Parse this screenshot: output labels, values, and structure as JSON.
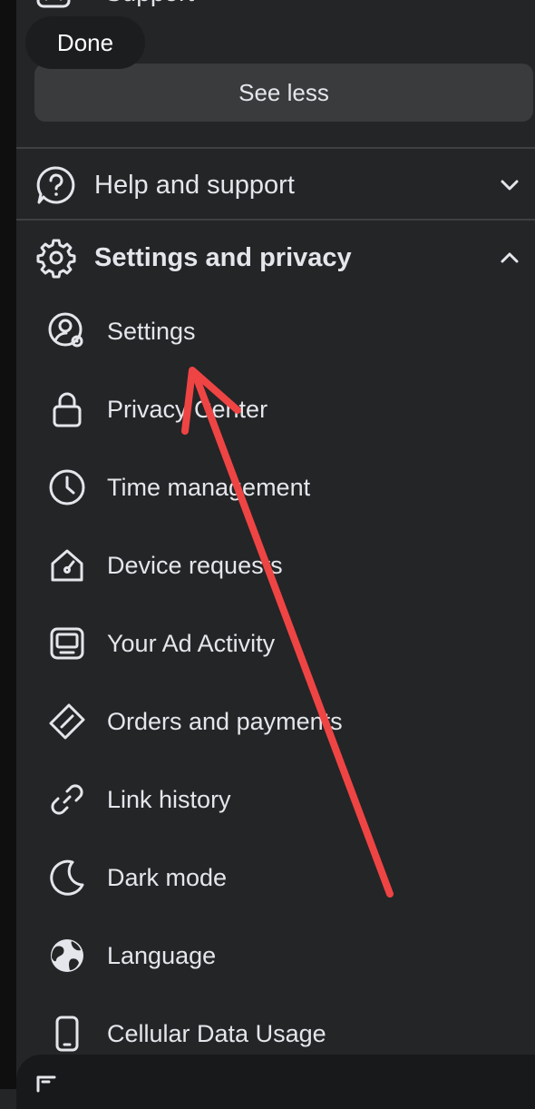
{
  "top": {
    "support_label": "Support",
    "done_label": "Done",
    "see_less_label": "See less"
  },
  "sections": {
    "help": {
      "label": "Help and support",
      "icon": "question-bubble-icon",
      "expanded": false
    },
    "settings": {
      "label": "Settings and privacy",
      "icon": "gear-icon",
      "expanded": true
    }
  },
  "menu": [
    {
      "label": "Settings",
      "icon": "user-gear-icon"
    },
    {
      "label": "Privacy Center",
      "icon": "lock-icon"
    },
    {
      "label": "Time management",
      "icon": "clock-icon"
    },
    {
      "label": "Device requests",
      "icon": "house-gauge-icon"
    },
    {
      "label": "Your Ad Activity",
      "icon": "monitor-icon"
    },
    {
      "label": "Orders and payments",
      "icon": "tag-icon"
    },
    {
      "label": "Link history",
      "icon": "link-icon"
    },
    {
      "label": "Dark mode",
      "icon": "moon-icon"
    },
    {
      "label": "Language",
      "icon": "globe-icon"
    },
    {
      "label": "Cellular Data Usage",
      "icon": "phone-icon"
    }
  ],
  "colors": {
    "background": "#242526",
    "button": "#3a3b3c",
    "text": "#e4e6eb",
    "annotation_arrow": "#ef4444"
  }
}
